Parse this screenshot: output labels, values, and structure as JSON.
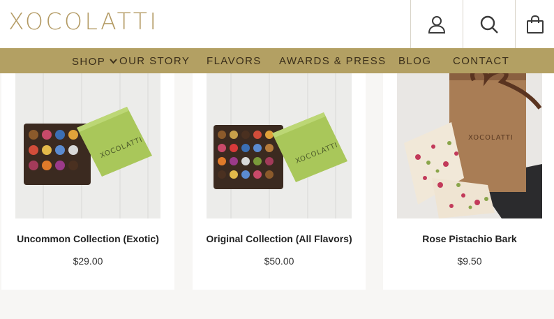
{
  "brand": {
    "name": "XOCOLATTI"
  },
  "header": {
    "icons": [
      "account-icon",
      "search-icon",
      "shopping-bag-icon"
    ]
  },
  "nav": {
    "items": [
      {
        "label": "SHOP",
        "has_dropdown": true
      },
      {
        "label": "OUR STORY"
      },
      {
        "label": "FLAVORS"
      },
      {
        "label": "AWARDS & PRESS"
      },
      {
        "label": "BLOG"
      },
      {
        "label": "CONTACT"
      }
    ]
  },
  "products": [
    {
      "name": "Uncommon Collection (Exotic)",
      "price": "$29.00",
      "box_text": "XOCOLATTI"
    },
    {
      "name": "Original Collection (All Flavors)",
      "price": "$50.00",
      "box_text": "XOCOLATTI"
    },
    {
      "name": "Rose Pistachio Bark",
      "price": "$9.50",
      "bag_text": "XOCOLATTI"
    }
  ],
  "colors": {
    "nav_bg": "#b3a063",
    "logo_gold": "#b39a63",
    "box_green": "#a9c75a",
    "bag_brown": "#a97d55"
  }
}
